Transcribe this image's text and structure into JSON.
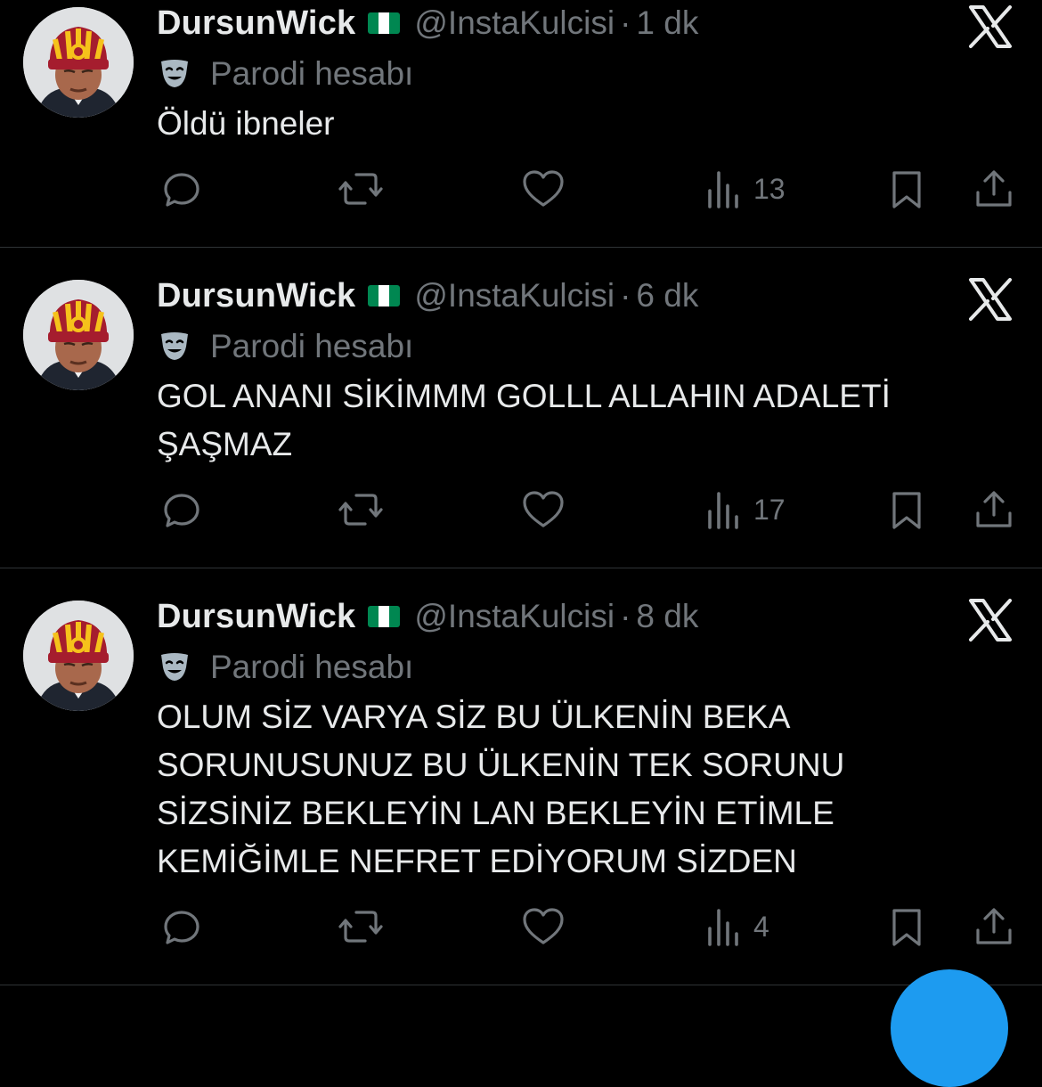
{
  "colors": {
    "background": "#000000",
    "text_primary": "#e7e9ea",
    "text_secondary": "#71767b",
    "divider": "#2f3336",
    "accent_fab": "#1d9bf0"
  },
  "tweets": [
    {
      "display_name": "DursunWick",
      "flag_icon": "nigeria-flag-icon",
      "handle": "@InstaKulcisi",
      "separator": "·",
      "time": "1 dk",
      "parody_label": "Parodi hesabı",
      "text": "Öldü ibneler",
      "views": "13"
    },
    {
      "display_name": "DursunWick",
      "flag_icon": "nigeria-flag-icon",
      "handle": "@InstaKulcisi",
      "separator": "·",
      "time": "6 dk",
      "parody_label": "Parodi hesabı",
      "text": "GOL ANANI SİKİMMM GOLLL ALLAHIN ADALETİ\nŞAŞMAZ",
      "views": "17"
    },
    {
      "display_name": "DursunWick",
      "flag_icon": "nigeria-flag-icon",
      "handle": "@InstaKulcisi",
      "separator": "·",
      "time": "8 dk",
      "parody_label": "Parodi hesabı",
      "text": "OLUM SİZ VARYA SİZ BU ÜLKENİN BEKA\nSORUNUSUNUZ BU ÜLKENİN TEK SORUNU\nSİZSİNİZ BEKLEYİN LAN BEKLEYİN ETİMLE\nKEMİĞİMLE NEFRET EDİYORUM SİZDEN",
      "views": "4"
    }
  ],
  "icons": {
    "reply": "reply-icon",
    "retweet": "retweet-icon",
    "like": "like-icon",
    "views": "views-icon",
    "bookmark": "bookmark-icon",
    "share": "share-icon",
    "close": "x-logo-icon",
    "parody": "theater-mask-icon"
  }
}
